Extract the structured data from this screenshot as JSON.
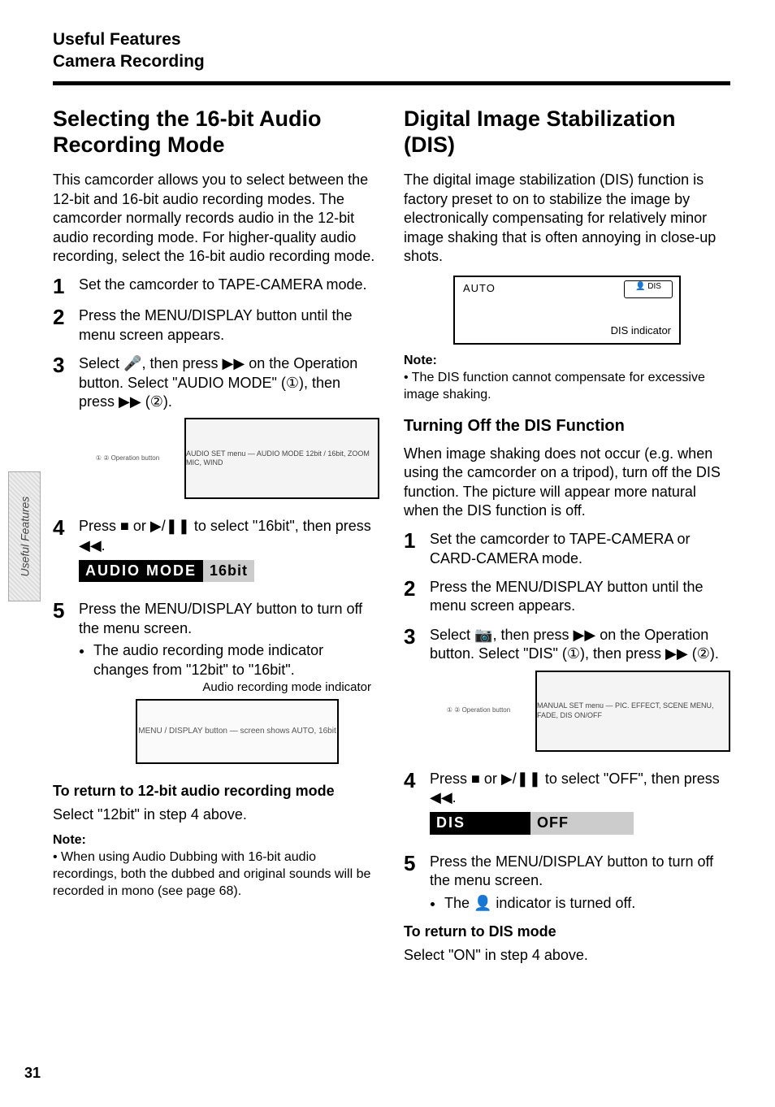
{
  "header": {
    "line1": "Useful Features",
    "line2": "Camera Recording"
  },
  "side_tab": "Useful Features",
  "page_number": "31",
  "left": {
    "title": "Selecting the 16-bit Audio Recording Mode",
    "intro": "This camcorder allows you to select between the 12-bit and 16-bit audio recording modes. The camcorder normally records audio in the 12-bit audio recording mode. For higher-quality audio recording, select the 16-bit audio recording mode.",
    "steps": {
      "s1": "Set the camcorder to TAPE-CAMERA mode.",
      "s2": "Press the MENU/DISPLAY button until the menu screen appears.",
      "s3_a": "Select ",
      "s3_b": ", then press ▶▶ on the Operation button. Select \"AUDIO MODE\" (①), then press ▶▶ (②).",
      "s4_a": "Press ■ or ▶/❚❚ to select \"16bit\", then press ◀◀.",
      "s5_a": "Press the MENU/DISPLAY button to turn off the menu screen.",
      "s5_b": "The audio recording mode indicator changes from \"12bit\" to \"16bit\"."
    },
    "figure_menu": {
      "label": "AUDIO SET menu — AUDIO MODE 12bit / 16bit, ZOOM MIC, WIND"
    },
    "indicator": {
      "dark": "AUDIO MODE",
      "light": "16bit"
    },
    "indicator_caption": "Audio recording mode indicator",
    "menu_display_label": "MENU / DISPLAY button — screen shows AUTO, 16bit",
    "return_head": "To return to 12-bit audio recording mode",
    "return_body": "Select \"12bit\" in step 4 above.",
    "note_label": "Note:",
    "note_body": "When using Audio Dubbing with 16-bit audio recordings, both the dubbed and original sounds will be recorded in mono (see page 68)."
  },
  "right": {
    "title": "Digital Image Stabilization (DIS)",
    "intro": "The digital image stabilization (DIS) function is factory preset to on to stabilize the image by electronically compensating for relatively minor image shaking that is often annoying in close-up shots.",
    "dis_box": {
      "auto": "AUTO",
      "label": "DIS indicator"
    },
    "note_label": "Note:",
    "note_body": "The DIS function cannot compensate for excessive image shaking.",
    "sub_title": "Turning Off the DIS Function",
    "sub_intro": "When image shaking does not occur (e.g. when using the camcorder on a tripod), turn off the DIS function. The picture will appear more natural when the DIS function is off.",
    "steps": {
      "s1": "Set the camcorder to TAPE-CAMERA or CARD-CAMERA mode.",
      "s2": "Press the MENU/DISPLAY button until the menu screen appears.",
      "s3_a": "Select ",
      "s3_b": ", then press ▶▶ on the Operation button. Select \"DIS\" (①), then press ▶▶ (②).",
      "s4": "Press ■ or ▶/❚❚ to select \"OFF\", then press ◀◀.",
      "s5_a": "Press the MENU/DISPLAY button to turn off the menu screen.",
      "s5_b": "The 👤 indicator is turned off."
    },
    "figure_menu": {
      "label": "MANUAL SET menu — PIC. EFFECT, SCENE MENU, FADE, DIS ON/OFF"
    },
    "indicator": {
      "dark": "DIS",
      "light": "OFF"
    },
    "return_head": "To return to DIS mode",
    "return_body": "Select \"ON\" in step 4 above."
  },
  "icons": {
    "mic": "🎤",
    "camera": "📷"
  }
}
